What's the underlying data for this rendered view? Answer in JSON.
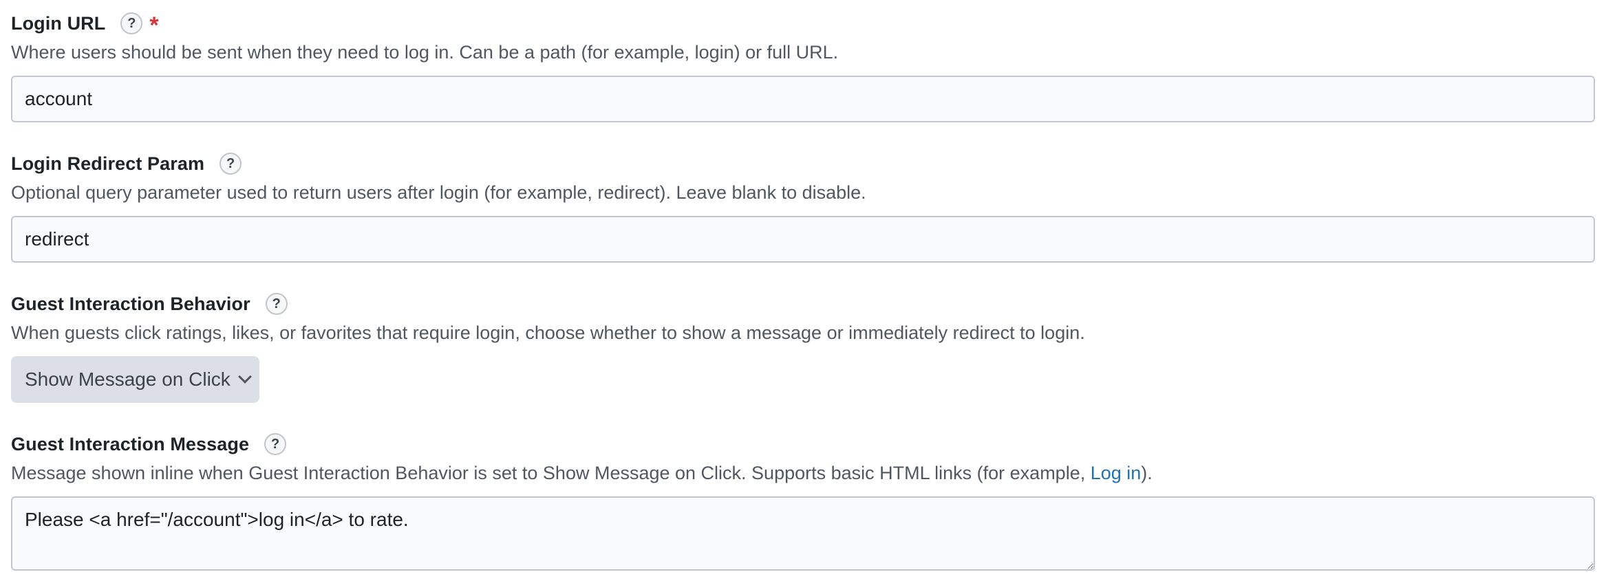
{
  "login_url": {
    "label": "Login URL",
    "help": "?",
    "required_mark": "*",
    "description": "Where users should be sent when they need to log in. Can be a path (for example, login) or full URL.",
    "value": "account"
  },
  "login_redirect_param": {
    "label": "Login Redirect Param",
    "help": "?",
    "description": "Optional query parameter used to return users after login (for example, redirect). Leave blank to disable.",
    "value": "redirect"
  },
  "guest_interaction_behavior": {
    "label": "Guest Interaction Behavior",
    "help": "?",
    "description": "When guests click ratings, likes, or favorites that require login, choose whether to show a message or immediately redirect to login.",
    "selected": "Show Message on Click"
  },
  "guest_interaction_message": {
    "label": "Guest Interaction Message",
    "help": "?",
    "description_before": "Message shown inline when Guest Interaction Behavior is set to Show Message on Click. Supports basic HTML links (for example, ",
    "description_link": "Log in",
    "description_after": ").",
    "value": "Please <a href=\"/account\">log in</a> to rate."
  },
  "colors": {
    "required": "#d63638",
    "link": "#2271b1",
    "input_border": "#c3c8d0",
    "select_bg": "#dcdfe5"
  }
}
